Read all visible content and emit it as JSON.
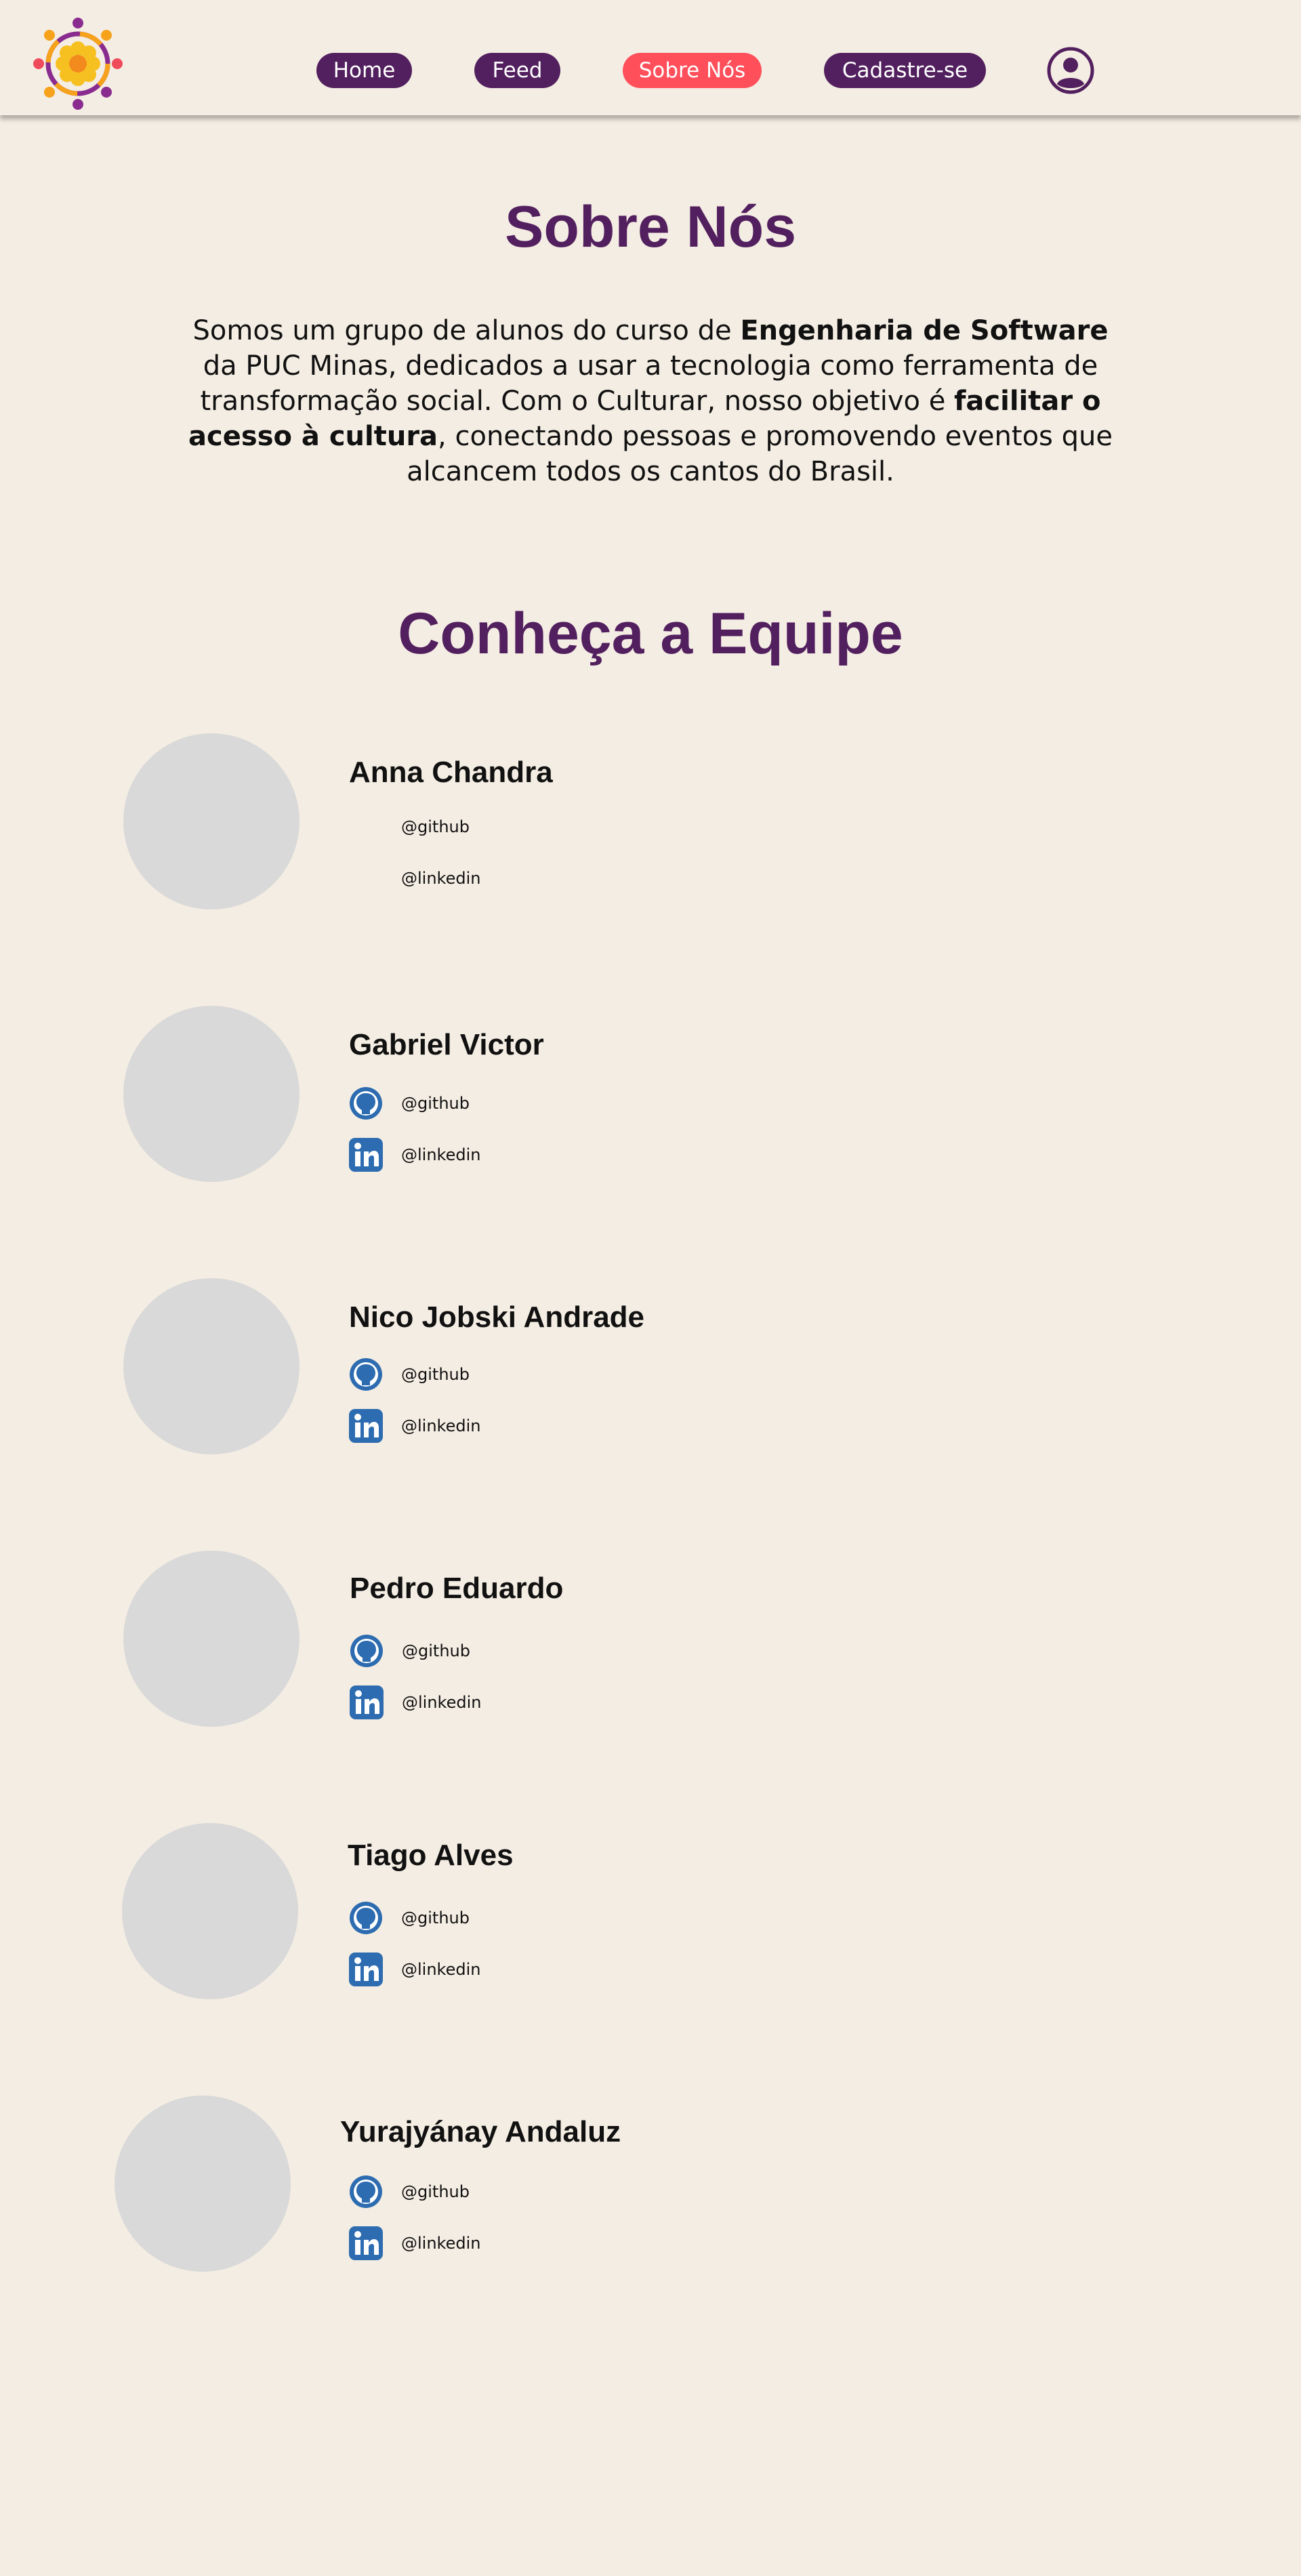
{
  "nav": {
    "home": "Home",
    "feed": "Feed",
    "sobre": "Sobre Nós",
    "cadastre": "Cadastre-se"
  },
  "colors": {
    "background": "#f4ede3",
    "primary": "#53205f",
    "accent": "#ff4f5a",
    "avatar_placeholder": "#d9d9d9"
  },
  "about": {
    "title": "Sobre Nós",
    "intro_part1": "Somos um grupo de alunos do curso de ",
    "intro_bold1": "Engenharia de Software",
    "intro_part2": " da PUC Minas, dedicados a usar a tecnologia como ferramenta de transformação social. Com o Culturar, nosso objetivo é ",
    "intro_bold2": "facilitar o acesso à cultura",
    "intro_part3": ", conectando pessoas e promovendo eventos que alcancem todos os cantos do Brasil."
  },
  "team": {
    "title": "Conheça a Equipe",
    "members": [
      {
        "name": "Anna Chandra",
        "github": "@github",
        "linkedin": "@linkedin",
        "icons_visible": false
      },
      {
        "name": "Gabriel Victor",
        "github": "@github",
        "linkedin": "@linkedin",
        "icons_visible": true
      },
      {
        "name": "Nico Jobski Andrade",
        "github": "@github",
        "linkedin": "@linkedin",
        "icons_visible": true
      },
      {
        "name": "Pedro Eduardo",
        "github": "@github",
        "linkedin": "@linkedin",
        "icons_visible": true
      },
      {
        "name": "Tiago Alves",
        "github": "@github",
        "linkedin": "@linkedin",
        "icons_visible": true
      },
      {
        "name": "Yurajyánay Andaluz",
        "github": "@github",
        "linkedin": "@linkedin",
        "icons_visible": true
      }
    ]
  }
}
